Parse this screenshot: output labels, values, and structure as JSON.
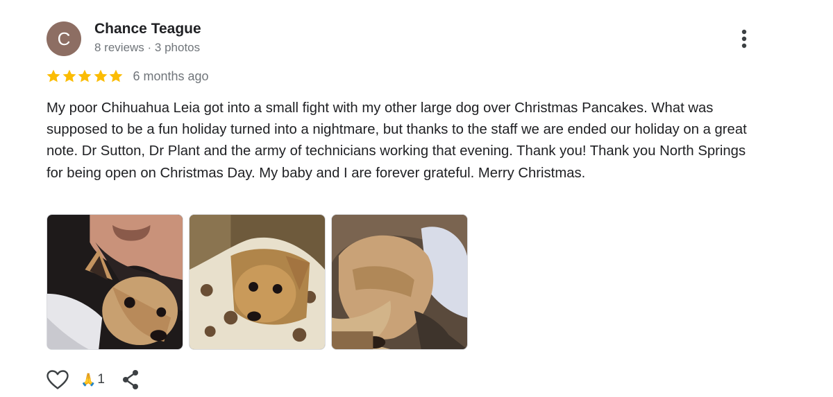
{
  "author": {
    "initial": "C",
    "name": "Chance Teague",
    "meta": "8 reviews · 3 photos",
    "avatar_color": "#8d6e63"
  },
  "rating": {
    "stars": 5,
    "max": 5,
    "star_color": "#fbbc04",
    "time": "6 months ago"
  },
  "review": {
    "text": "My poor Chihuahua Leia got into a small fight with my other large dog over Christmas Pancakes. What was supposed to be a fun holiday turned into a nightmare, but thanks to the staff we are ended our holiday on a great note. Dr Sutton, Dr Plant and the army of technicians working that evening. Thank you! Thank you North Springs for being open on Christmas Day. My baby and I are forever grateful. Merry Christmas."
  },
  "photos": [
    {
      "icon": "photo-chihuahua-held"
    },
    {
      "icon": "photo-chihuahua-blanket"
    },
    {
      "icon": "photo-chihuahua-sweater"
    }
  ],
  "actions": {
    "like_icon": "heart-outline-icon",
    "reaction_emoji": "🙏",
    "reaction_count": "1",
    "share_icon": "share-icon"
  },
  "menu_icon": "more-vert-icon"
}
